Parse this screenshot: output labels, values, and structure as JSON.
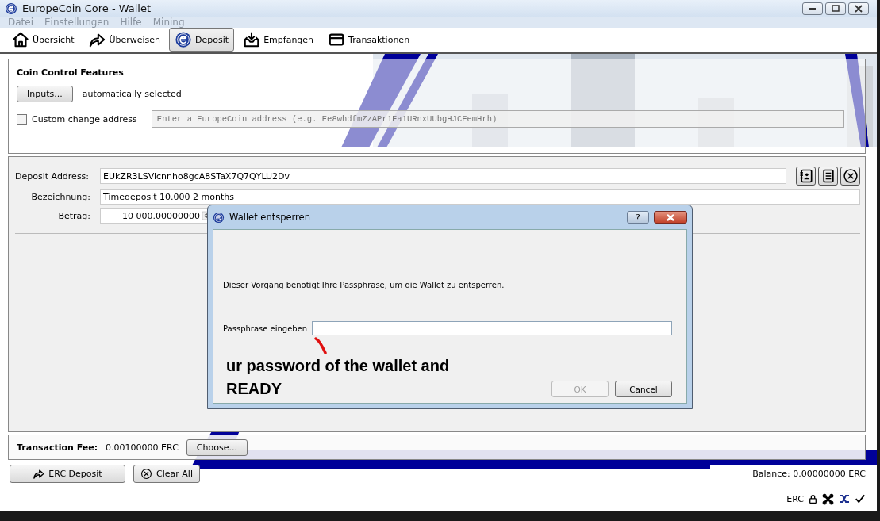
{
  "window": {
    "title": "EuropeCoin Core - Wallet"
  },
  "menu": [
    "Datei",
    "Einstellungen",
    "Hilfe",
    "Mining"
  ],
  "toolbar": [
    {
      "label": "Übersicht",
      "kind": "home",
      "selected": false
    },
    {
      "label": "Überweisen",
      "kind": "send",
      "selected": false
    },
    {
      "label": "Deposit",
      "kind": "coin",
      "selected": true
    },
    {
      "label": "Empfangen",
      "kind": "inbox",
      "selected": false
    },
    {
      "label": "Transaktionen",
      "kind": "card",
      "selected": false
    }
  ],
  "coin_control": {
    "title": "Coin Control Features",
    "inputs_button": "Inputs...",
    "inputs_status": "automatically selected",
    "custom_change": {
      "label": "Custom change address",
      "checked": false,
      "placeholder": "Enter a EuropeCoin address (e.g. Ee8whdfmZzAPr1Fa1URnxUUbgHJCFemHrh)"
    }
  },
  "deposit": {
    "address_label": "Deposit Address:",
    "address": "EUkZR3LSVicnnho8gcA8STaX7Q7QYLU2Dv",
    "label_label": "Bezeichnung:",
    "label_value": "Timedeposit 10.000 2 months",
    "amount_label": "Betrag:",
    "amount": "10 000.00000000"
  },
  "fee": {
    "label": "Transaction Fee:",
    "value": "0.00100000 ERC",
    "button": "Choose..."
  },
  "actions": [
    {
      "label": "ERC Deposit",
      "kind": "send"
    },
    {
      "label": "Clear All",
      "kind": "clear"
    }
  ],
  "balance": "Balance: 0.00000000 ERC",
  "status_bar": {
    "unit": "ERC"
  },
  "dialog": {
    "title": "Wallet entsperren",
    "help": "?",
    "message": "Dieser Vorgang benötigt Ihre Passphrase, um die Wallet zu entsperren.",
    "field_label": "Passphrase eingeben",
    "ok": {
      "label": "OK",
      "disabled": true
    },
    "cancel": {
      "label": "Cancel",
      "disabled": false
    }
  },
  "annotation": "ur password of the wallet and READY"
}
